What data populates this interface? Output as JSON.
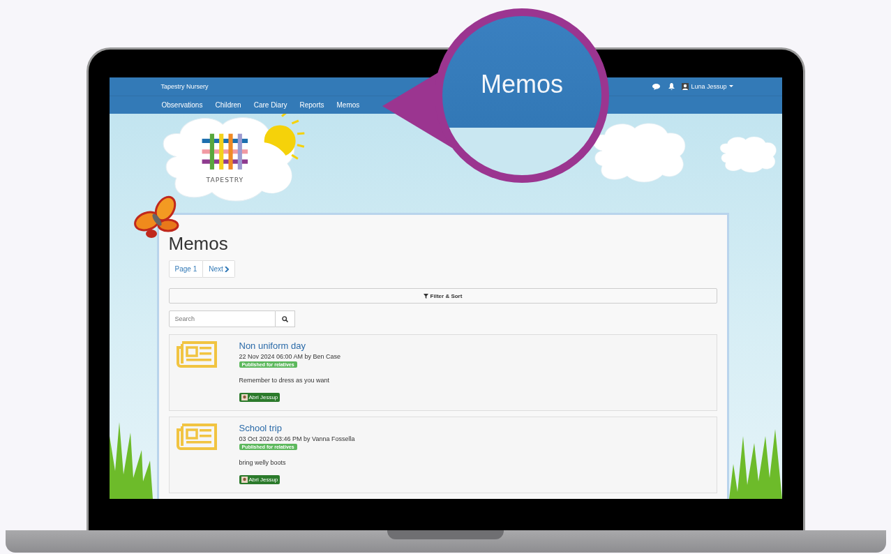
{
  "header": {
    "site_name": "Tapestry Nursery",
    "user": "Luna Jessup",
    "nav": [
      {
        "label": "Observations"
      },
      {
        "label": "Children"
      },
      {
        "label": "Care Diary"
      },
      {
        "label": "Reports"
      },
      {
        "label": "Memos"
      }
    ]
  },
  "logo": {
    "text": "TAPESTRY"
  },
  "magnifier": {
    "label": "Memos"
  },
  "page": {
    "title": "Memos",
    "pagination": {
      "page": "Page 1",
      "next": "Next"
    },
    "filter": "Filter & Sort",
    "search": {
      "placeholder": "Search"
    }
  },
  "memos": [
    {
      "title": "Non uniform day",
      "meta": "22 Nov 2024 06:00 AM by Ben Case",
      "status": "Published for relatives",
      "body": "Remember to dress as you want",
      "child": "Abri Jessup"
    },
    {
      "title": "School trip",
      "meta": "03 Oct 2024 03:46 PM by Vanna Fossella",
      "status": "Published for relatives",
      "body": "bring welly boots",
      "child": "Abri Jessup"
    }
  ]
}
